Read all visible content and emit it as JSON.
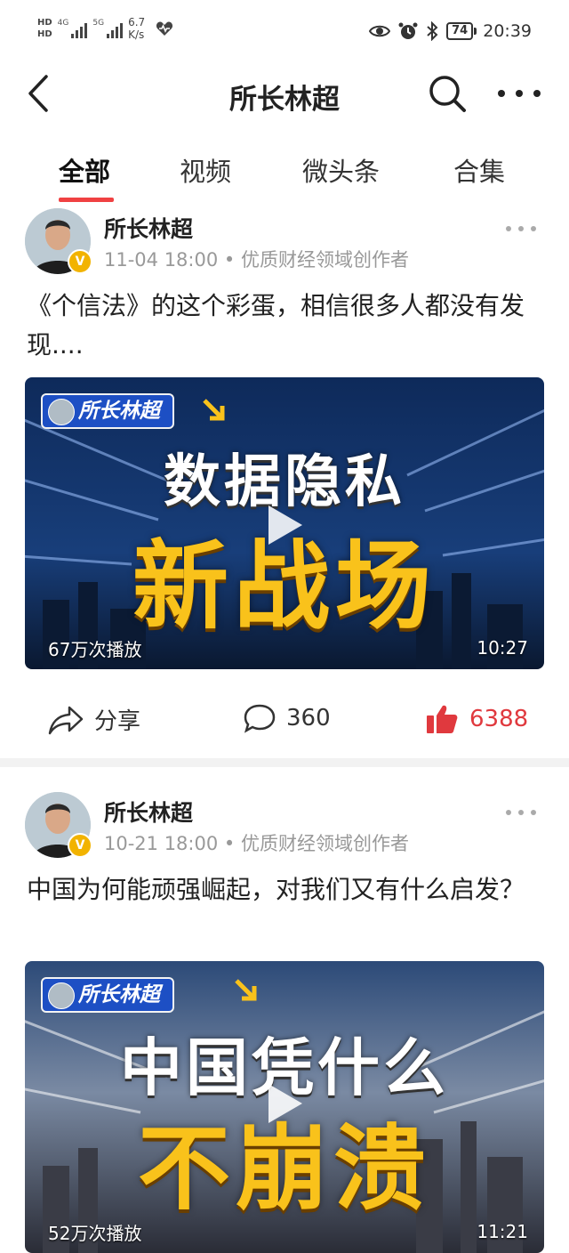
{
  "status_bar": {
    "hd1": "HD",
    "hd2": "HD",
    "net1": "4G",
    "net2": "5G",
    "speed_value": "6.7",
    "speed_unit": "K/s",
    "battery": "74",
    "time": "20:39",
    "icons": [
      "eye-icon",
      "alarm-icon",
      "bluetooth-icon",
      "heart-icon"
    ]
  },
  "header": {
    "title": "所长林超",
    "back_icon": "back-arrow-icon",
    "search_icon": "search-icon",
    "more_icon": "more-icon"
  },
  "tabs": [
    {
      "label": "全部",
      "active": true
    },
    {
      "label": "视频",
      "active": false
    },
    {
      "label": "微头条",
      "active": false
    },
    {
      "label": "合集",
      "active": false
    }
  ],
  "posts": [
    {
      "author": "所长林超",
      "verified_badge": "V",
      "meta": "11-04 18:00 • 优质财经领域创作者",
      "text": "《个信法》的这个彩蛋，相信很多人都没有发现....",
      "thumb": {
        "badge": "所长林超",
        "line1": "数据隐私",
        "line2": "新战场",
        "views": "67万次播放",
        "duration": "10:27"
      },
      "share_label": "分享",
      "comments": "360",
      "likes": "6388"
    },
    {
      "author": "所长林超",
      "verified_badge": "V",
      "meta": "10-21 18:00 • 优质财经领域创作者",
      "text": "中国为何能顽强崛起，对我们又有什么启发？",
      "thumb": {
        "badge": "所长林超",
        "line1": "中国凭什么",
        "line2": "不崩溃",
        "views": "52万次播放",
        "duration": "11:21"
      }
    }
  ],
  "colors": {
    "accent": "#f04142",
    "like": "#e0393e",
    "badge_blue": "#1d4fc4",
    "title_yellow": "#f9c21b"
  }
}
